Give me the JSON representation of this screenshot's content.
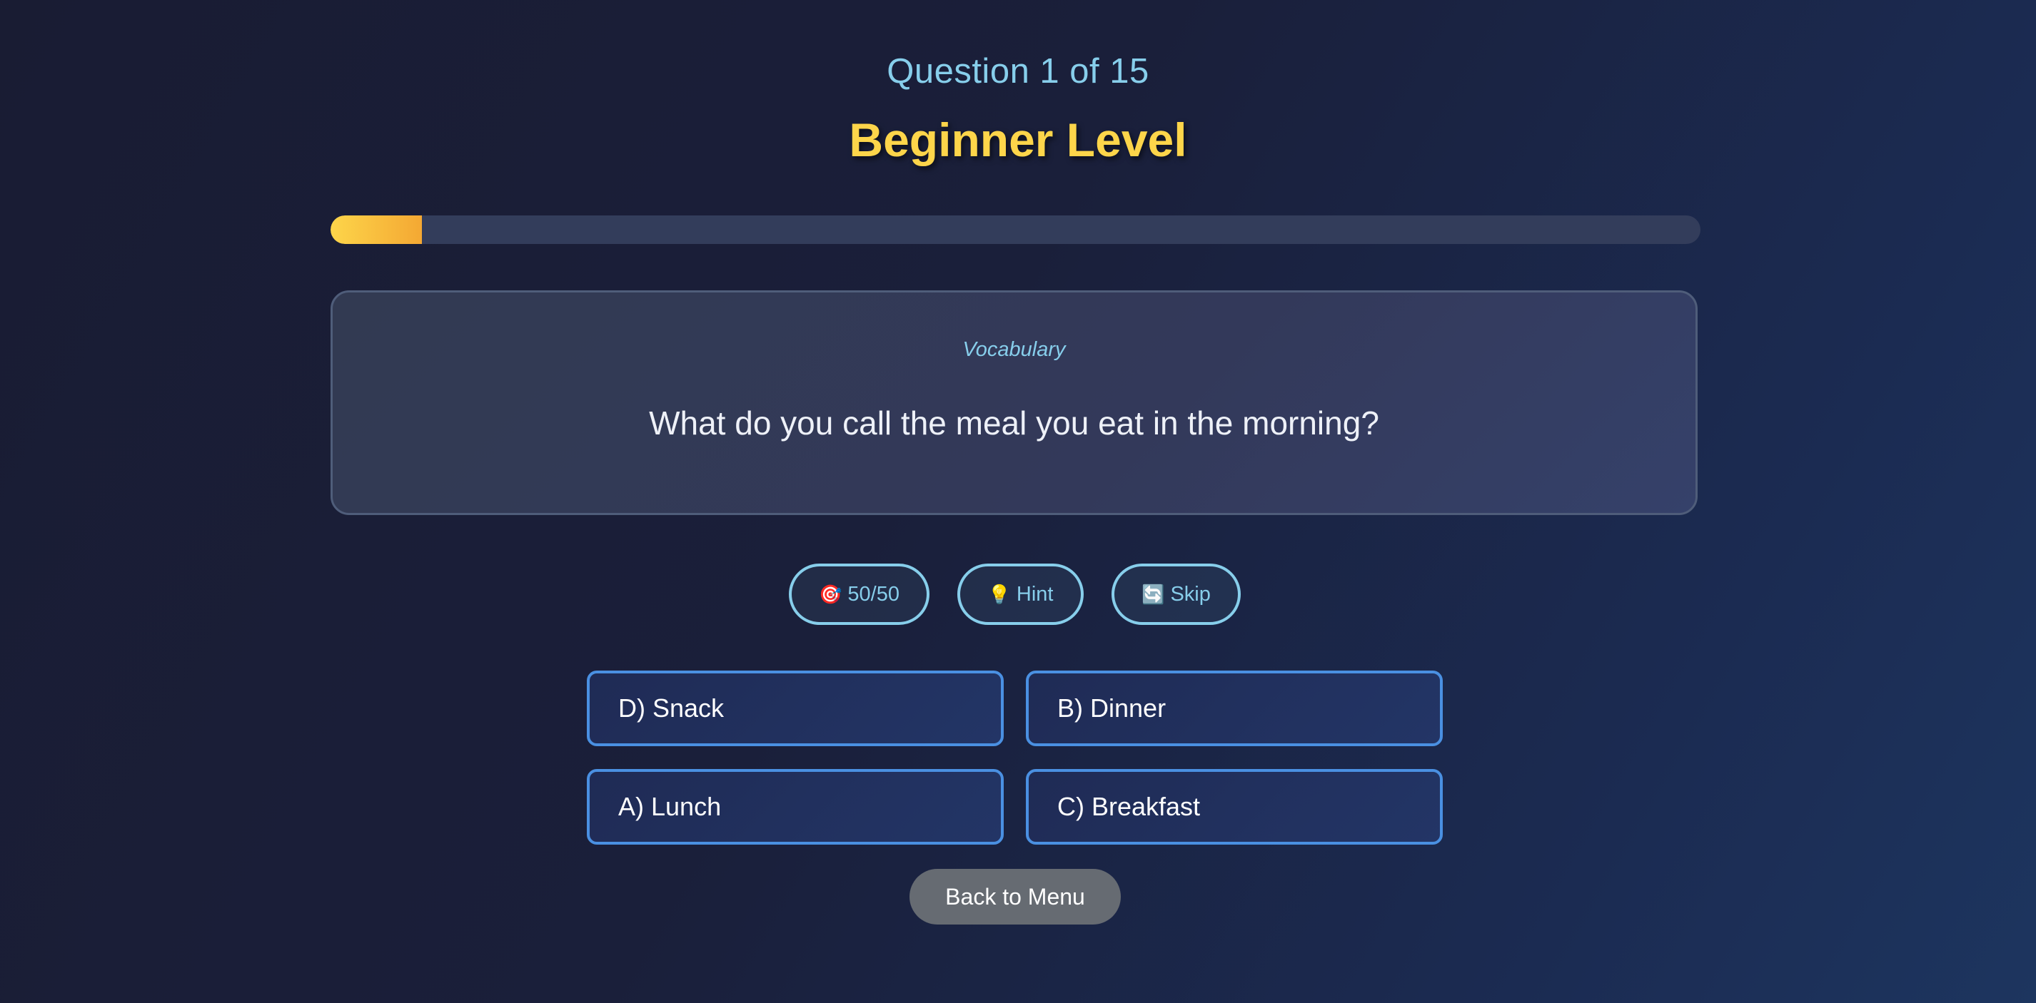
{
  "header": {
    "question_counter": "Question 1 of 15",
    "level_title": "Beginner Level"
  },
  "progress": {
    "fraction": 0.0667
  },
  "question": {
    "category": "Vocabulary",
    "text": "What do you call the meal you eat in the morning?"
  },
  "lifelines": [
    {
      "icon": "target-icon",
      "glyph": "🎯",
      "label": "50/50"
    },
    {
      "icon": "lightbulb-icon",
      "glyph": "💡",
      "label": "Hint"
    },
    {
      "icon": "refresh-icon",
      "glyph": "🔄",
      "label": "Skip"
    }
  ],
  "answers": [
    {
      "label": "D) Snack"
    },
    {
      "label": "B) Dinner"
    },
    {
      "label": "A) Lunch"
    },
    {
      "label": "C) Breakfast"
    }
  ],
  "footer": {
    "back_label": "Back to Menu"
  },
  "colors": {
    "accent_yellow": "#fdd54a",
    "accent_blue": "#87ceeb",
    "answer_border": "#4a90e2",
    "back_button": "#666b72"
  }
}
